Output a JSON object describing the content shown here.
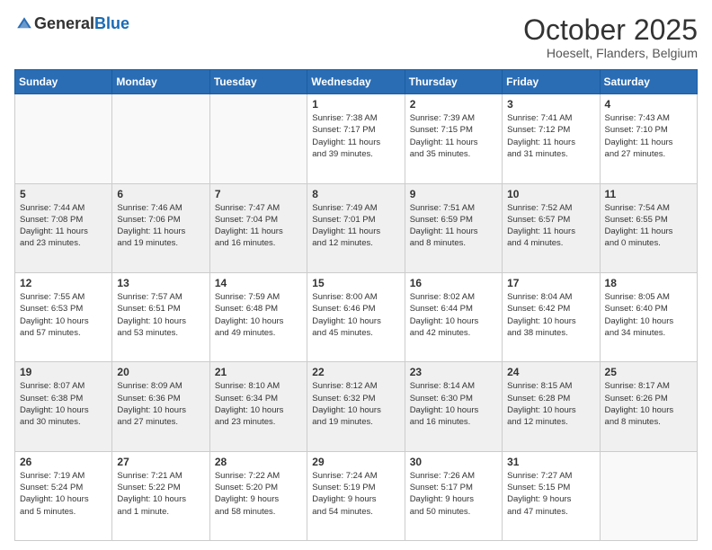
{
  "logo": {
    "general": "General",
    "blue": "Blue"
  },
  "header": {
    "month": "October 2025",
    "location": "Hoeselt, Flanders, Belgium"
  },
  "weekdays": [
    "Sunday",
    "Monday",
    "Tuesday",
    "Wednesday",
    "Thursday",
    "Friday",
    "Saturday"
  ],
  "weeks": [
    [
      {
        "day": "",
        "info": ""
      },
      {
        "day": "",
        "info": ""
      },
      {
        "day": "",
        "info": ""
      },
      {
        "day": "1",
        "info": "Sunrise: 7:38 AM\nSunset: 7:17 PM\nDaylight: 11 hours\nand 39 minutes."
      },
      {
        "day": "2",
        "info": "Sunrise: 7:39 AM\nSunset: 7:15 PM\nDaylight: 11 hours\nand 35 minutes."
      },
      {
        "day": "3",
        "info": "Sunrise: 7:41 AM\nSunset: 7:12 PM\nDaylight: 11 hours\nand 31 minutes."
      },
      {
        "day": "4",
        "info": "Sunrise: 7:43 AM\nSunset: 7:10 PM\nDaylight: 11 hours\nand 27 minutes."
      }
    ],
    [
      {
        "day": "5",
        "info": "Sunrise: 7:44 AM\nSunset: 7:08 PM\nDaylight: 11 hours\nand 23 minutes."
      },
      {
        "day": "6",
        "info": "Sunrise: 7:46 AM\nSunset: 7:06 PM\nDaylight: 11 hours\nand 19 minutes."
      },
      {
        "day": "7",
        "info": "Sunrise: 7:47 AM\nSunset: 7:04 PM\nDaylight: 11 hours\nand 16 minutes."
      },
      {
        "day": "8",
        "info": "Sunrise: 7:49 AM\nSunset: 7:01 PM\nDaylight: 11 hours\nand 12 minutes."
      },
      {
        "day": "9",
        "info": "Sunrise: 7:51 AM\nSunset: 6:59 PM\nDaylight: 11 hours\nand 8 minutes."
      },
      {
        "day": "10",
        "info": "Sunrise: 7:52 AM\nSunset: 6:57 PM\nDaylight: 11 hours\nand 4 minutes."
      },
      {
        "day": "11",
        "info": "Sunrise: 7:54 AM\nSunset: 6:55 PM\nDaylight: 11 hours\nand 0 minutes."
      }
    ],
    [
      {
        "day": "12",
        "info": "Sunrise: 7:55 AM\nSunset: 6:53 PM\nDaylight: 10 hours\nand 57 minutes."
      },
      {
        "day": "13",
        "info": "Sunrise: 7:57 AM\nSunset: 6:51 PM\nDaylight: 10 hours\nand 53 minutes."
      },
      {
        "day": "14",
        "info": "Sunrise: 7:59 AM\nSunset: 6:48 PM\nDaylight: 10 hours\nand 49 minutes."
      },
      {
        "day": "15",
        "info": "Sunrise: 8:00 AM\nSunset: 6:46 PM\nDaylight: 10 hours\nand 45 minutes."
      },
      {
        "day": "16",
        "info": "Sunrise: 8:02 AM\nSunset: 6:44 PM\nDaylight: 10 hours\nand 42 minutes."
      },
      {
        "day": "17",
        "info": "Sunrise: 8:04 AM\nSunset: 6:42 PM\nDaylight: 10 hours\nand 38 minutes."
      },
      {
        "day": "18",
        "info": "Sunrise: 8:05 AM\nSunset: 6:40 PM\nDaylight: 10 hours\nand 34 minutes."
      }
    ],
    [
      {
        "day": "19",
        "info": "Sunrise: 8:07 AM\nSunset: 6:38 PM\nDaylight: 10 hours\nand 30 minutes."
      },
      {
        "day": "20",
        "info": "Sunrise: 8:09 AM\nSunset: 6:36 PM\nDaylight: 10 hours\nand 27 minutes."
      },
      {
        "day": "21",
        "info": "Sunrise: 8:10 AM\nSunset: 6:34 PM\nDaylight: 10 hours\nand 23 minutes."
      },
      {
        "day": "22",
        "info": "Sunrise: 8:12 AM\nSunset: 6:32 PM\nDaylight: 10 hours\nand 19 minutes."
      },
      {
        "day": "23",
        "info": "Sunrise: 8:14 AM\nSunset: 6:30 PM\nDaylight: 10 hours\nand 16 minutes."
      },
      {
        "day": "24",
        "info": "Sunrise: 8:15 AM\nSunset: 6:28 PM\nDaylight: 10 hours\nand 12 minutes."
      },
      {
        "day": "25",
        "info": "Sunrise: 8:17 AM\nSunset: 6:26 PM\nDaylight: 10 hours\nand 8 minutes."
      }
    ],
    [
      {
        "day": "26",
        "info": "Sunrise: 7:19 AM\nSunset: 5:24 PM\nDaylight: 10 hours\nand 5 minutes."
      },
      {
        "day": "27",
        "info": "Sunrise: 7:21 AM\nSunset: 5:22 PM\nDaylight: 10 hours\nand 1 minute."
      },
      {
        "day": "28",
        "info": "Sunrise: 7:22 AM\nSunset: 5:20 PM\nDaylight: 9 hours\nand 58 minutes."
      },
      {
        "day": "29",
        "info": "Sunrise: 7:24 AM\nSunset: 5:19 PM\nDaylight: 9 hours\nand 54 minutes."
      },
      {
        "day": "30",
        "info": "Sunrise: 7:26 AM\nSunset: 5:17 PM\nDaylight: 9 hours\nand 50 minutes."
      },
      {
        "day": "31",
        "info": "Sunrise: 7:27 AM\nSunset: 5:15 PM\nDaylight: 9 hours\nand 47 minutes."
      },
      {
        "day": "",
        "info": ""
      }
    ]
  ]
}
